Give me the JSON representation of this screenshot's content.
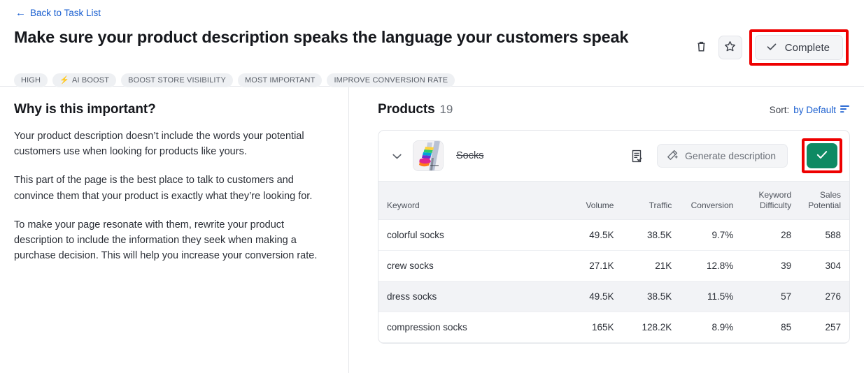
{
  "header": {
    "back_link": "Back to Task List",
    "back_icon": "arrow-left-icon",
    "title": "Make sure your product description speaks the language your customers speak",
    "tags": [
      {
        "label": "HIGH",
        "icon": null
      },
      {
        "label": "AI BOOST",
        "icon": "bolt-icon"
      },
      {
        "label": "BOOST STORE VISIBILITY",
        "icon": null
      },
      {
        "label": "MOST IMPORTANT",
        "icon": null
      },
      {
        "label": "IMPROVE CONVERSION RATE",
        "icon": null
      }
    ],
    "actions": {
      "delete_icon": "trash-icon",
      "favorite_icon": "star-icon",
      "complete_label": "Complete",
      "complete_icon": "check-icon"
    }
  },
  "left": {
    "heading": "Why is this important?",
    "paragraphs": [
      "Your product description doesn’t include the words your potential customers use when looking for products like yours.",
      "This part of the page is the best place to talk to customers and convince them that your product is exactly what they’re looking for.",
      "To make your page resonate with them, rewrite your product description to include the information they seek when making a purchase decision. This will help you increase your conversion rate."
    ]
  },
  "right": {
    "products_label": "Products",
    "products_count": "19",
    "sort_label": "Sort:",
    "sort_value": "by Default",
    "sort_icon": "sort-descending-icon",
    "product": {
      "expand_icon": "chevron-down-icon",
      "thumbnail_alt": "colorful-socks-photo",
      "name": "Socks",
      "notes_icon": "document-check-icon",
      "generate_label": "Generate description",
      "generate_icon": "magic-wand-icon",
      "confirm_icon": "check-icon"
    },
    "table": {
      "columns": [
        "Keyword",
        "Volume",
        "Traffic",
        "Conversion",
        "Keyword Difficulty",
        "Sales Potential"
      ],
      "rows": [
        {
          "keyword": "colorful socks",
          "volume": "49.5K",
          "traffic": "38.5K",
          "conversion": "9.7%",
          "difficulty": "28",
          "potential": "588"
        },
        {
          "keyword": "crew socks",
          "volume": "27.1K",
          "traffic": "21K",
          "conversion": "12.8%",
          "difficulty": "39",
          "potential": "304"
        },
        {
          "keyword": "dress socks",
          "volume": "49.5K",
          "traffic": "38.5K",
          "conversion": "11.5%",
          "difficulty": "57",
          "potential": "276"
        },
        {
          "keyword": "compression socks",
          "volume": "165K",
          "traffic": "128.2K",
          "conversion": "8.9%",
          "difficulty": "85",
          "potential": "257"
        }
      ]
    }
  },
  "colors": {
    "link": "#1a5fd0",
    "accent_green": "#0e8a63",
    "annotation_red": "#ee0000",
    "tag_bg": "#eef0f3"
  }
}
